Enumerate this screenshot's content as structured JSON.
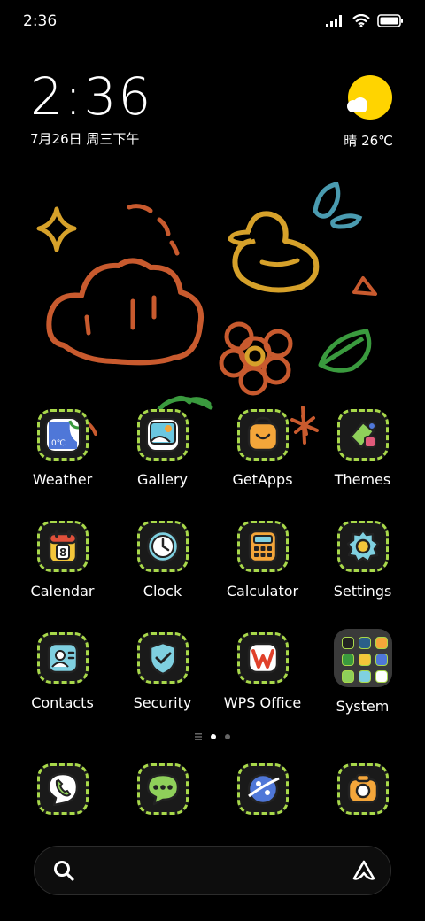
{
  "status_bar": {
    "time": "2:36",
    "icons": [
      "signal-icon",
      "wifi-icon",
      "battery-icon"
    ]
  },
  "clock_widget": {
    "time": "2:36",
    "date": "7月26日 周三下午"
  },
  "weather_widget": {
    "condition": "晴",
    "temperature": "26℃",
    "icon": "sun-cloud-icon",
    "accent": "#ffd400"
  },
  "apps": [
    [
      {
        "label": "Weather",
        "icon": "weather-icon"
      },
      {
        "label": "Gallery",
        "icon": "gallery-icon"
      },
      {
        "label": "GetApps",
        "icon": "getapps-icon"
      },
      {
        "label": "Themes",
        "icon": "themes-icon"
      }
    ],
    [
      {
        "label": "Calendar",
        "icon": "calendar-icon"
      },
      {
        "label": "Clock",
        "icon": "clock-icon"
      },
      {
        "label": "Calculator",
        "icon": "calculator-icon"
      },
      {
        "label": "Settings",
        "icon": "settings-icon"
      }
    ],
    [
      {
        "label": "Contacts",
        "icon": "contacts-icon"
      },
      {
        "label": "Security",
        "icon": "security-icon"
      },
      {
        "label": "WPS Office",
        "icon": "wps-office-icon"
      },
      {
        "label": "System",
        "icon": "folder-icon"
      }
    ]
  ],
  "weather_icon_text": "0℃",
  "calendar_icon_text": "8",
  "dock": [
    {
      "icon": "phone-icon"
    },
    {
      "icon": "messages-icon"
    },
    {
      "icon": "browser-icon"
    },
    {
      "icon": "camera-icon"
    }
  ],
  "page_indicator": {
    "pages": 2,
    "current": 1
  },
  "search_bar": {
    "icons": [
      "search-icon",
      "assistant-icon"
    ]
  },
  "colors": {
    "icon_border": "#a8d84a",
    "background": "#000000"
  }
}
